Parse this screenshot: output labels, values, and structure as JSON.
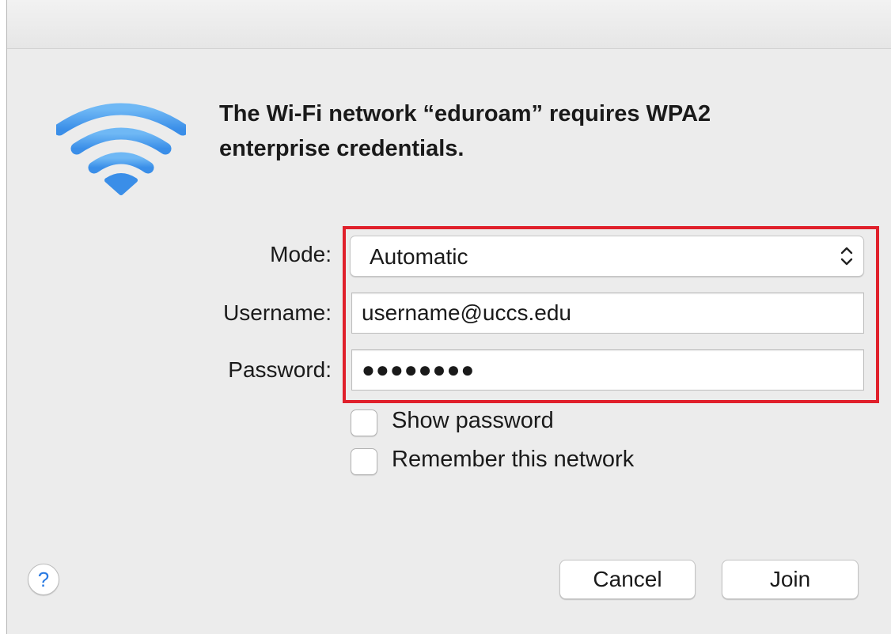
{
  "dialog": {
    "icon": "wifi-icon",
    "headline_line1": "The Wi-Fi network “eduroam” requires WPA2",
    "headline_line2": "enterprise credentials."
  },
  "form": {
    "mode_label": "Mode:",
    "mode_value": "Automatic",
    "username_label": "Username:",
    "username_value": "username@uccs.edu",
    "password_label": "Password:",
    "password_value": "●●●●●●●●"
  },
  "options": {
    "show_password_label": "Show password",
    "show_password_checked": false,
    "remember_network_label": "Remember this network",
    "remember_network_checked": false
  },
  "buttons": {
    "help_label": "?",
    "cancel_label": "Cancel",
    "join_label": "Join"
  },
  "colors": {
    "wifi_blue": "#4a9ff0",
    "highlight_red": "#e0202b"
  }
}
